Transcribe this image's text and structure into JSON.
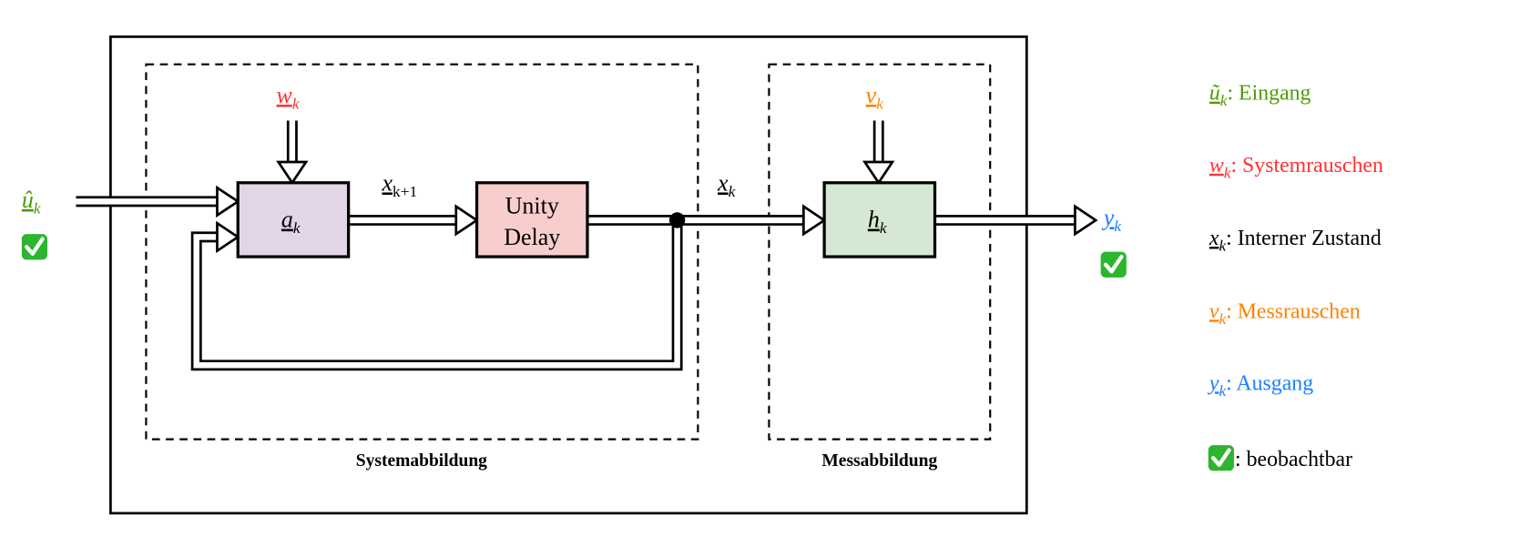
{
  "colors": {
    "input": "#4e9a06",
    "system_noise": "#ff3333",
    "state": "#000000",
    "measurement_noise": "#ff8000",
    "output": "#1a7fff",
    "box_a": "#e1d5e7",
    "box_delay": "#f8cecc",
    "box_h": "#d5e8d4"
  },
  "diagram": {
    "input_label": {
      "symbol": "û",
      "sub": "k"
    },
    "system_noise_label": {
      "symbol": "w",
      "sub": "k"
    },
    "measurement_noise_label": {
      "symbol": "v",
      "sub": "k"
    },
    "next_state_label": {
      "symbol": "x",
      "sub": "k+1"
    },
    "state_label": {
      "symbol": "x",
      "sub": "k"
    },
    "output_label": {
      "symbol": "y",
      "sub": "k"
    },
    "box_a": {
      "symbol": "a",
      "sub": "k"
    },
    "box_delay": {
      "line1": "Unity",
      "line2": "Delay"
    },
    "box_h": {
      "symbol": "h",
      "sub": "k"
    },
    "section_system": "Systemabbildung",
    "section_measurement": "Messabbildung",
    "observable_icon": "check-mark-button-icon"
  },
  "legend": [
    {
      "symbol": "ũ",
      "sub": "k",
      "text": ": Eingang",
      "color": "#4e9a06"
    },
    {
      "symbol": "w",
      "sub": "k",
      "text": ": Systemrauschen",
      "color": "#ff3333"
    },
    {
      "symbol": "x",
      "sub": "k",
      "text": ": Interner Zustand",
      "color": "#000000"
    },
    {
      "symbol": "v",
      "sub": "k",
      "text": ": Messrauschen",
      "color": "#ff8000"
    },
    {
      "symbol": "y",
      "sub": "k",
      "text": ": Ausgang",
      "color": "#1a7fff"
    },
    {
      "icon": "check-mark-button-icon",
      "text": ": beobachtbar",
      "color": "#000000"
    }
  ]
}
